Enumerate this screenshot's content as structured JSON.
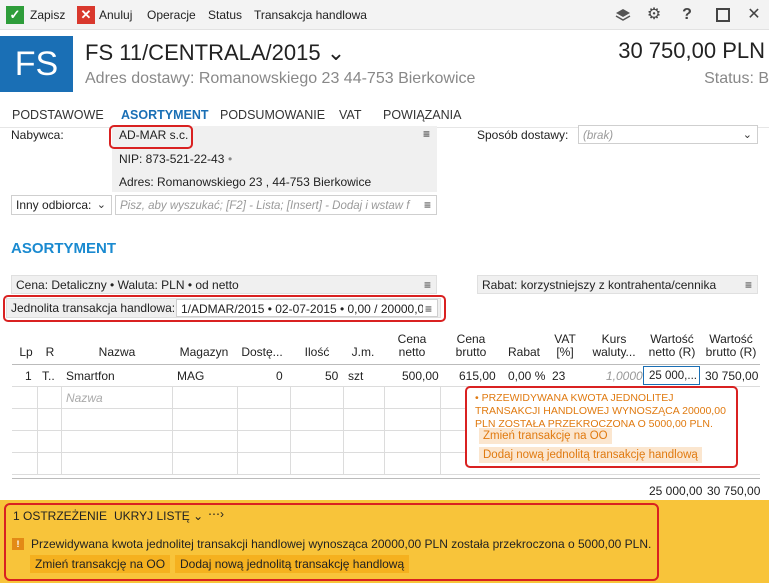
{
  "toolbar": {
    "save_label": "Zapisz",
    "cancel_label": "Anuluj",
    "operations_label": "Operacje",
    "status_label": "Status",
    "trade_transaction_label": "Transakcja handlowa"
  },
  "header": {
    "logo": "FS",
    "title": "FS 11/CENTRALA/2015 ⌄",
    "address": "Adres dostawy: Romanowskiego 23  44-753 Bierkowice",
    "amount": "30 750,00 PLN",
    "status": "Status: B"
  },
  "tabs": [
    "PODSTAWOWE",
    "ASORTYMENT",
    "PODSUMOWANIE",
    "VAT",
    "POWIĄZANIA"
  ],
  "buyer": {
    "label": "Nabywca:",
    "name": "AD-MAR s.c.",
    "nip": "NIP:  873-521-22-43",
    "address": "Adres:  Romanowskiego 23 , 44-753 Bierkowice"
  },
  "delivery": {
    "label": "Sposób dostawy:",
    "value": "(brak)"
  },
  "other_receiver": {
    "label": "Inny odbiorca:",
    "placeholder": "Pisz, aby wyszukać; [F2] - Lista; [Insert] - Dodaj i wstaw f"
  },
  "section_title": "ASORTYMENT",
  "price_bar": "Cena: Detaliczny • Waluta: PLN • od netto",
  "discount_bar": "Rabat: korzystniejszy z kontrahenta/cennika",
  "jth": {
    "label": "Jednolita transakcja handlowa:",
    "value": "1/ADMAR/2015 • 02-07-2015 • 0,00 / 20000,0"
  },
  "table": {
    "headers": [
      "Lp",
      "R",
      "Nazwa",
      "Magazyn",
      "Dostę...",
      "Ilość",
      "J.m.",
      "Cena netto",
      "Cena brutto",
      "Rabat",
      "VAT [%]",
      "Kurs waluty...",
      "Wartość netto (R)",
      "Wartość brutto (R)"
    ],
    "row": {
      "lp": "1",
      "r": "T..",
      "name": "Smartfon",
      "warehouse": "MAG",
      "available": "0",
      "qty": "50",
      "unit": "szt",
      "net_price": "500,00",
      "gross_price": "615,00",
      "discount": "0,00 %",
      "vat": "23",
      "rate": "1,0000",
      "net_value": "25 000,...",
      "gross_value": "30 750,00"
    },
    "new_row_placeholder": "Nazwa",
    "totals": {
      "net": "25 000,00",
      "gross": "30 750,00"
    }
  },
  "tooltip": {
    "text": "• PRZEWIDYWANA KWOTA JEDNOLITEJ TRANSAKCJI HANDLOWEJ WYNOSZĄCA 20000,00 PLN ZOSTAŁA PRZEKROCZONA O 5000,00 PLN.",
    "change_btn": "Zmień transakcję na OO",
    "add_btn": "Dodaj nową jednolitą transakcję handlową"
  },
  "warning": {
    "count": "1 OSTRZEŻENIE",
    "hide_list": "UKRYJ LISTĘ ⌄",
    "message": "Przewidywana kwota jednolitej transakcji handlowej wynosząca 20000,00 PLN została przekroczona o 5000,00 PLN.",
    "change_btn": "Zmień transakcję na OO",
    "add_btn": "Dodaj nową jednolitą transakcję handlową"
  },
  "colors": {
    "accent": "#1a6fb5",
    "warning_bg": "#f8c43a",
    "alert_red": "#d92121",
    "tooltip_orange": "#e07a10"
  }
}
